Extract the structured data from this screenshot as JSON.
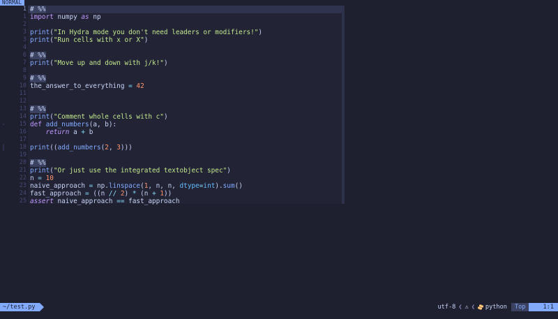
{
  "mode": "NORMAL",
  "file": "~/test.py",
  "status": {
    "encoding": "utf-8",
    "sep1": "❮",
    "os_glyph": "⚠",
    "sep2": "❮",
    "filetype_icon": "python-icon",
    "filetype": "python",
    "position": "Top",
    "cursor": "1:1"
  },
  "colors": {
    "accent": "#82aaff",
    "background": "#1e2030",
    "cell_background": "#222436",
    "string": "#c3e88d",
    "keyword": "#c099ff",
    "number": "#ff966c"
  },
  "lines": [
    {
      "num": "1",
      "current": true,
      "tokens": [
        [
          "mark",
          "# %%"
        ]
      ]
    },
    {
      "num": "1",
      "tokens": [
        [
          "kw",
          "import"
        ],
        [
          "id",
          " numpy "
        ],
        [
          "it",
          "as"
        ],
        [
          "id",
          " np"
        ]
      ]
    },
    {
      "num": "2",
      "tokens": []
    },
    {
      "num": "3",
      "tokens": [
        [
          "fn",
          "print"
        ],
        [
          "id",
          "("
        ],
        [
          "str",
          "\"In Hydra mode you don't need leaders or modifiers!\""
        ],
        [
          "id",
          ")"
        ]
      ]
    },
    {
      "num": "3",
      "tokens": [
        [
          "fn",
          "print"
        ],
        [
          "id",
          "("
        ],
        [
          "str",
          "\"Run cells with x or X\""
        ],
        [
          "id",
          ")"
        ]
      ]
    },
    {
      "num": "4",
      "tokens": []
    },
    {
      "num": "6",
      "tokens": [
        [
          "mark",
          "# %%"
        ]
      ]
    },
    {
      "num": "7",
      "tokens": [
        [
          "fn",
          "print"
        ],
        [
          "id",
          "("
        ],
        [
          "str",
          "\"Move up and down with j/k!\""
        ],
        [
          "id",
          ")"
        ]
      ]
    },
    {
      "num": "8",
      "tokens": []
    },
    {
      "num": "9",
      "tokens": [
        [
          "mark",
          "# %%"
        ]
      ]
    },
    {
      "num": "10",
      "tokens": [
        [
          "id",
          "the_answer_to_everything "
        ],
        [
          "op",
          "="
        ],
        [
          "id",
          " "
        ],
        [
          "num",
          "42"
        ]
      ]
    },
    {
      "num": "11",
      "tokens": []
    },
    {
      "num": "12",
      "tokens": []
    },
    {
      "num": "13",
      "tokens": [
        [
          "mark",
          "# %%"
        ]
      ]
    },
    {
      "num": "14",
      "tokens": [
        [
          "fn",
          "print"
        ],
        [
          "id",
          "("
        ],
        [
          "str",
          "\"Comment whole cells with c\""
        ],
        [
          "id",
          ")"
        ]
      ]
    },
    {
      "num": "15",
      "gutter": "-",
      "tokens": [
        [
          "kw",
          "def"
        ],
        [
          "id",
          " "
        ],
        [
          "fn",
          "add_numbers"
        ],
        [
          "id",
          "(a, b):"
        ]
      ]
    },
    {
      "num": "16",
      "tokens": [
        [
          "id",
          "    "
        ],
        [
          "it",
          "return"
        ],
        [
          "id",
          " a "
        ],
        [
          "op",
          "+"
        ],
        [
          "id",
          " b"
        ]
      ]
    },
    {
      "num": "17",
      "tokens": []
    },
    {
      "num": "18",
      "gutter": "|",
      "tokens": [
        [
          "fn",
          "print"
        ],
        [
          "id",
          "(("
        ],
        [
          "fn",
          "add_numbers"
        ],
        [
          "id",
          "("
        ],
        [
          "num",
          "2"
        ],
        [
          "id",
          ", "
        ],
        [
          "num",
          "3"
        ],
        [
          "id",
          ")))"
        ]
      ]
    },
    {
      "num": "19",
      "tokens": []
    },
    {
      "num": "20",
      "tokens": [
        [
          "mark",
          "# %%"
        ]
      ]
    },
    {
      "num": "21",
      "tokens": [
        [
          "fn",
          "print"
        ],
        [
          "id",
          "("
        ],
        [
          "str",
          "\"Or just use the integrated textobject spec\""
        ],
        [
          "id",
          ")"
        ]
      ]
    },
    {
      "num": "22",
      "tokens": [
        [
          "id",
          "n "
        ],
        [
          "op",
          "="
        ],
        [
          "id",
          " "
        ],
        [
          "num",
          "10"
        ]
      ]
    },
    {
      "num": "23",
      "tokens": [
        [
          "id",
          "naive_approach "
        ],
        [
          "op",
          "="
        ],
        [
          "id",
          " np."
        ],
        [
          "fn",
          "linspace"
        ],
        [
          "id",
          "("
        ],
        [
          "num",
          "1"
        ],
        [
          "id",
          ", n, n, "
        ],
        [
          "type",
          "dtype"
        ],
        [
          "op",
          "="
        ],
        [
          "type",
          "int"
        ],
        [
          "id",
          ")."
        ],
        [
          "fn",
          "sum"
        ],
        [
          "id",
          "()"
        ]
      ]
    },
    {
      "num": "24",
      "tokens": [
        [
          "id",
          "fast_approach "
        ],
        [
          "op",
          "="
        ],
        [
          "id",
          " ((n "
        ],
        [
          "op",
          "//"
        ],
        [
          "id",
          " "
        ],
        [
          "num",
          "2"
        ],
        [
          "id",
          ") "
        ],
        [
          "op",
          "*"
        ],
        [
          "id",
          " (n "
        ],
        [
          "op",
          "+"
        ],
        [
          "id",
          " "
        ],
        [
          "num",
          "1"
        ],
        [
          "id",
          "))"
        ]
      ]
    },
    {
      "num": "25",
      "tokens": [
        [
          "it",
          "assert"
        ],
        [
          "id",
          " naive_approach "
        ],
        [
          "op",
          "=="
        ],
        [
          "id",
          " fast_approach"
        ]
      ]
    }
  ]
}
